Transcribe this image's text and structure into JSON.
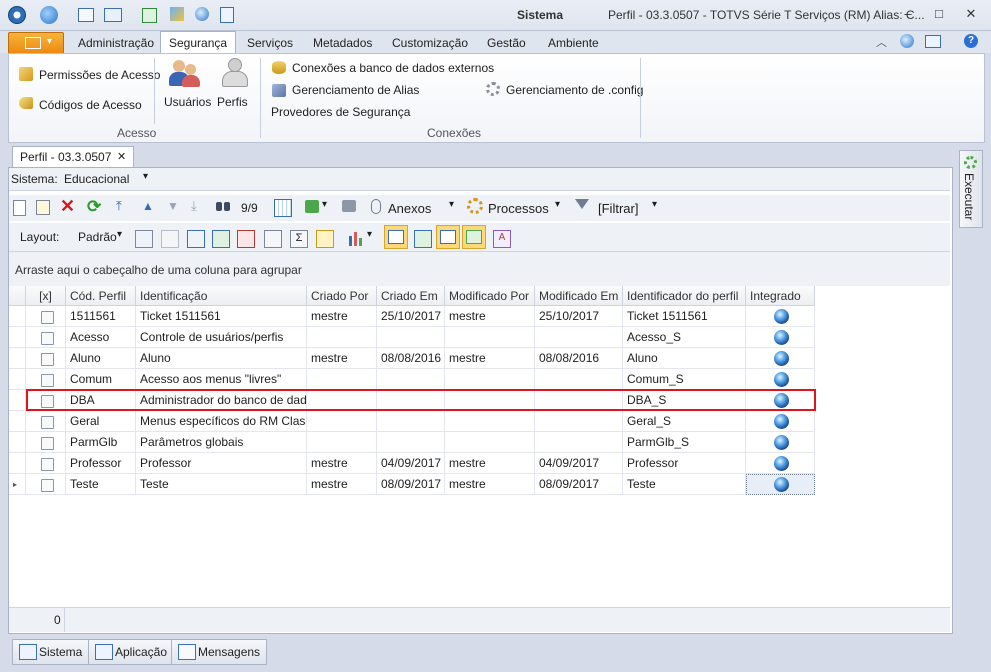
{
  "window": {
    "app_title": "Sistema",
    "doc_title": "Perfil - 03.3.0507 - TOTVS Série T Serviços (RM) Alias: C...",
    "minimize": "–",
    "maximize": "□",
    "close": "✕"
  },
  "ribbon_tabs": [
    "Administração",
    "Segurança",
    "Serviços",
    "Metadados",
    "Customização",
    "Gestão",
    "Ambiente"
  ],
  "ribbon": {
    "acesso": {
      "permissoes": "Permissões de Acesso",
      "codigos": "Códigos de Acesso",
      "usuarios": "Usuários",
      "perfis": "Perfis",
      "group_label": "Acesso"
    },
    "conexoes": {
      "bd_externos": "Conexões a banco de dados externos",
      "alias": "Gerenciamento de Alias",
      "provedores": "Provedores de Segurança",
      "config": "Gerenciamento de .config",
      "group_label": "Conexões"
    }
  },
  "doc_tab": {
    "label": "Perfil - 03.3.0507",
    "close": "✕"
  },
  "sistema": {
    "label": "Sistema:",
    "value": "Educacional"
  },
  "toolbar": {
    "counter": "9/9",
    "anexos": "Anexos",
    "processos": "Processos",
    "filtrar": "[Filtrar]",
    "layout_label": "Layout:",
    "layout_value": "Padrão"
  },
  "group_hint": "Arraste aqui o cabeçalho de uma coluna para agrupar",
  "grid": {
    "headers": [
      "[x]",
      "Cód. Perfil",
      "Identificação",
      "Criado Por",
      "Criado Em",
      "Modificado Por",
      "Modificado Em",
      "Identificador do perfil",
      "Integrado"
    ],
    "rows": [
      [
        "1511561",
        "Ticket 1511561",
        "mestre",
        "25/10/2017",
        "mestre",
        "25/10/2017",
        "Ticket 1511561"
      ],
      [
        "Acesso",
        "Controle de usuários/perfis",
        "",
        "",
        "",
        "",
        "Acesso_S"
      ],
      [
        "Aluno",
        "Aluno",
        "mestre",
        "08/08/2016",
        "mestre",
        "08/08/2016",
        "Aluno"
      ],
      [
        "Comum",
        "Acesso aos menus \"livres\"",
        "",
        "",
        "",
        "",
        "Comum_S"
      ],
      [
        "DBA",
        "Administrador do banco de dados",
        "",
        "",
        "",
        "",
        "DBA_S"
      ],
      [
        "Geral",
        "Menus específicos do RM Classi...",
        "",
        "",
        "",
        "",
        "Geral_S"
      ],
      [
        "ParmGlb",
        "Parâmetros globais",
        "",
        "",
        "",
        "",
        "ParmGlb_S"
      ],
      [
        "Professor",
        "Professor",
        "mestre",
        "04/09/2017",
        "mestre",
        "04/09/2017",
        "Professor"
      ],
      [
        "Teste",
        "Teste",
        "mestre",
        "08/09/2017",
        "mestre",
        "08/09/2017",
        "Teste"
      ]
    ],
    "footer_count": "0"
  },
  "bottom_tabs": [
    "Sistema",
    "Aplicação",
    "Mensagens"
  ],
  "side_tab": "Executar",
  "colors": {
    "highlight": "#e0141e",
    "accent": "#ee8a12",
    "selected_row": "#ffffff"
  }
}
